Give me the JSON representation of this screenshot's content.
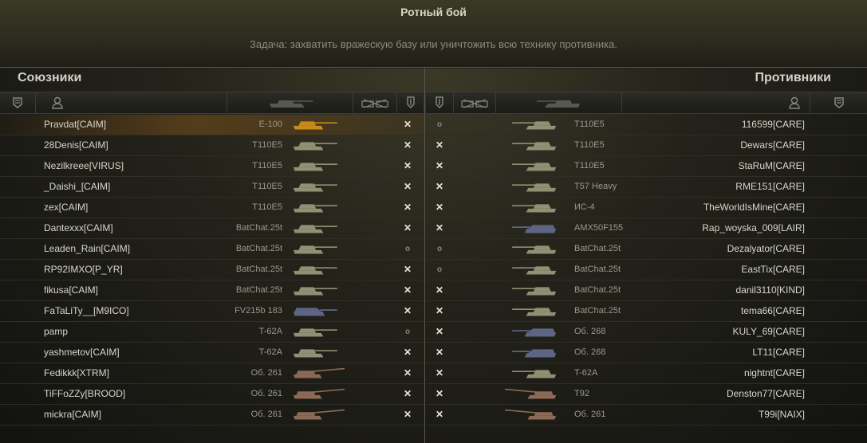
{
  "header": {
    "title": "Ротный бой",
    "task": "Задача: захватить вражескую базу или уничтожить всю технику противника."
  },
  "teams": {
    "allies_title": "Союзники",
    "enemies_title": "Противники"
  },
  "columns": {
    "icons": [
      "rank-icon",
      "player-icon",
      "tank-icon",
      "vehicle-class-icon",
      "status-icon"
    ]
  },
  "colors": {
    "tank_heavy": "#8e9173",
    "tank_medium": "#8e9173",
    "tank_td": "#5e6483",
    "tank_art": "#8c6a55",
    "tank_player": "#c98a1c",
    "highlight": "#8c5a19"
  },
  "allies": [
    {
      "player": "Pravdat[CAIM]",
      "tank": "E-100",
      "status": "dead",
      "tank_type": "player"
    },
    {
      "player": "28Denis[CAIM]",
      "tank": "T110E5",
      "status": "dead",
      "tank_type": "heavy"
    },
    {
      "player": "Nezilkreee[VIRUS]",
      "tank": "T110E5",
      "status": "dead",
      "tank_type": "heavy"
    },
    {
      "player": "_Daishi_[CAIM]",
      "tank": "T110E5",
      "status": "dead",
      "tank_type": "heavy"
    },
    {
      "player": "zex[CAIM]",
      "tank": "T110E5",
      "status": "dead",
      "tank_type": "heavy"
    },
    {
      "player": "Dantexxx[CAIM]",
      "tank": "BatChat.25t",
      "status": "dead",
      "tank_type": "medium"
    },
    {
      "player": "Leaden_Rain[CAIM]",
      "tank": "BatChat.25t",
      "status": "alive",
      "tank_type": "medium"
    },
    {
      "player": "RP92IMXO[P_YR]",
      "tank": "BatChat.25t",
      "status": "dead",
      "tank_type": "medium"
    },
    {
      "player": "fikusa[CAIM]",
      "tank": "BatChat.25t",
      "status": "dead",
      "tank_type": "medium"
    },
    {
      "player": "FaTaLiTy__[M9ICO]",
      "tank": "FV215b 183",
      "status": "dead",
      "tank_type": "td"
    },
    {
      "player": "pamp",
      "tank": "T-62A",
      "status": "alive",
      "tank_type": "medium"
    },
    {
      "player": "yashmetov[CAIM]",
      "tank": "T-62A",
      "status": "dead",
      "tank_type": "medium"
    },
    {
      "player": "Fedikkk[XTRM]",
      "tank": "Об. 261",
      "status": "dead",
      "tank_type": "art"
    },
    {
      "player": "TiFFoZZy[BROOD]",
      "tank": "Об. 261",
      "status": "dead",
      "tank_type": "art"
    },
    {
      "player": "mickra[CAIM]",
      "tank": "Об. 261",
      "status": "dead",
      "tank_type": "art"
    }
  ],
  "enemies": [
    {
      "player": "116599[CARE]",
      "tank": "T110E5",
      "status": "alive",
      "tank_type": "heavy"
    },
    {
      "player": "Dewars[CARE]",
      "tank": "T110E5",
      "status": "dead",
      "tank_type": "heavy"
    },
    {
      "player": "StaRuM[CARE]",
      "tank": "T110E5",
      "status": "dead",
      "tank_type": "heavy"
    },
    {
      "player": "RME151[CARE]",
      "tank": "T57 Heavy",
      "status": "dead",
      "tank_type": "heavy"
    },
    {
      "player": "TheWorldIsMine[CARE]",
      "tank": "ИС-4",
      "status": "dead",
      "tank_type": "heavy"
    },
    {
      "player": "Rap_woyska_009[LAIR]",
      "tank": "AMX50F155",
      "status": "dead",
      "tank_type": "td"
    },
    {
      "player": "Dezalyator[CARE]",
      "tank": "BatChat.25t",
      "status": "alive",
      "tank_type": "medium"
    },
    {
      "player": "EastTix[CARE]",
      "tank": "BatChat.25t",
      "status": "alive",
      "tank_type": "medium"
    },
    {
      "player": "danil3110[KIND]",
      "tank": "BatChat.25t",
      "status": "dead",
      "tank_type": "medium"
    },
    {
      "player": "tema66[CARE]",
      "tank": "BatChat.25t",
      "status": "dead",
      "tank_type": "medium"
    },
    {
      "player": "KULY_69[CARE]",
      "tank": "Об. 268",
      "status": "dead",
      "tank_type": "td"
    },
    {
      "player": "LT11[CARE]",
      "tank": "Об. 268",
      "status": "dead",
      "tank_type": "td"
    },
    {
      "player": "nightnt[CARE]",
      "tank": "T-62A",
      "status": "dead",
      "tank_type": "medium"
    },
    {
      "player": "Denston77[CARE]",
      "tank": "T92",
      "status": "dead",
      "tank_type": "art"
    },
    {
      "player": "T99i[NAIX]",
      "tank": "Об. 261",
      "status": "dead",
      "tank_type": "art"
    }
  ]
}
